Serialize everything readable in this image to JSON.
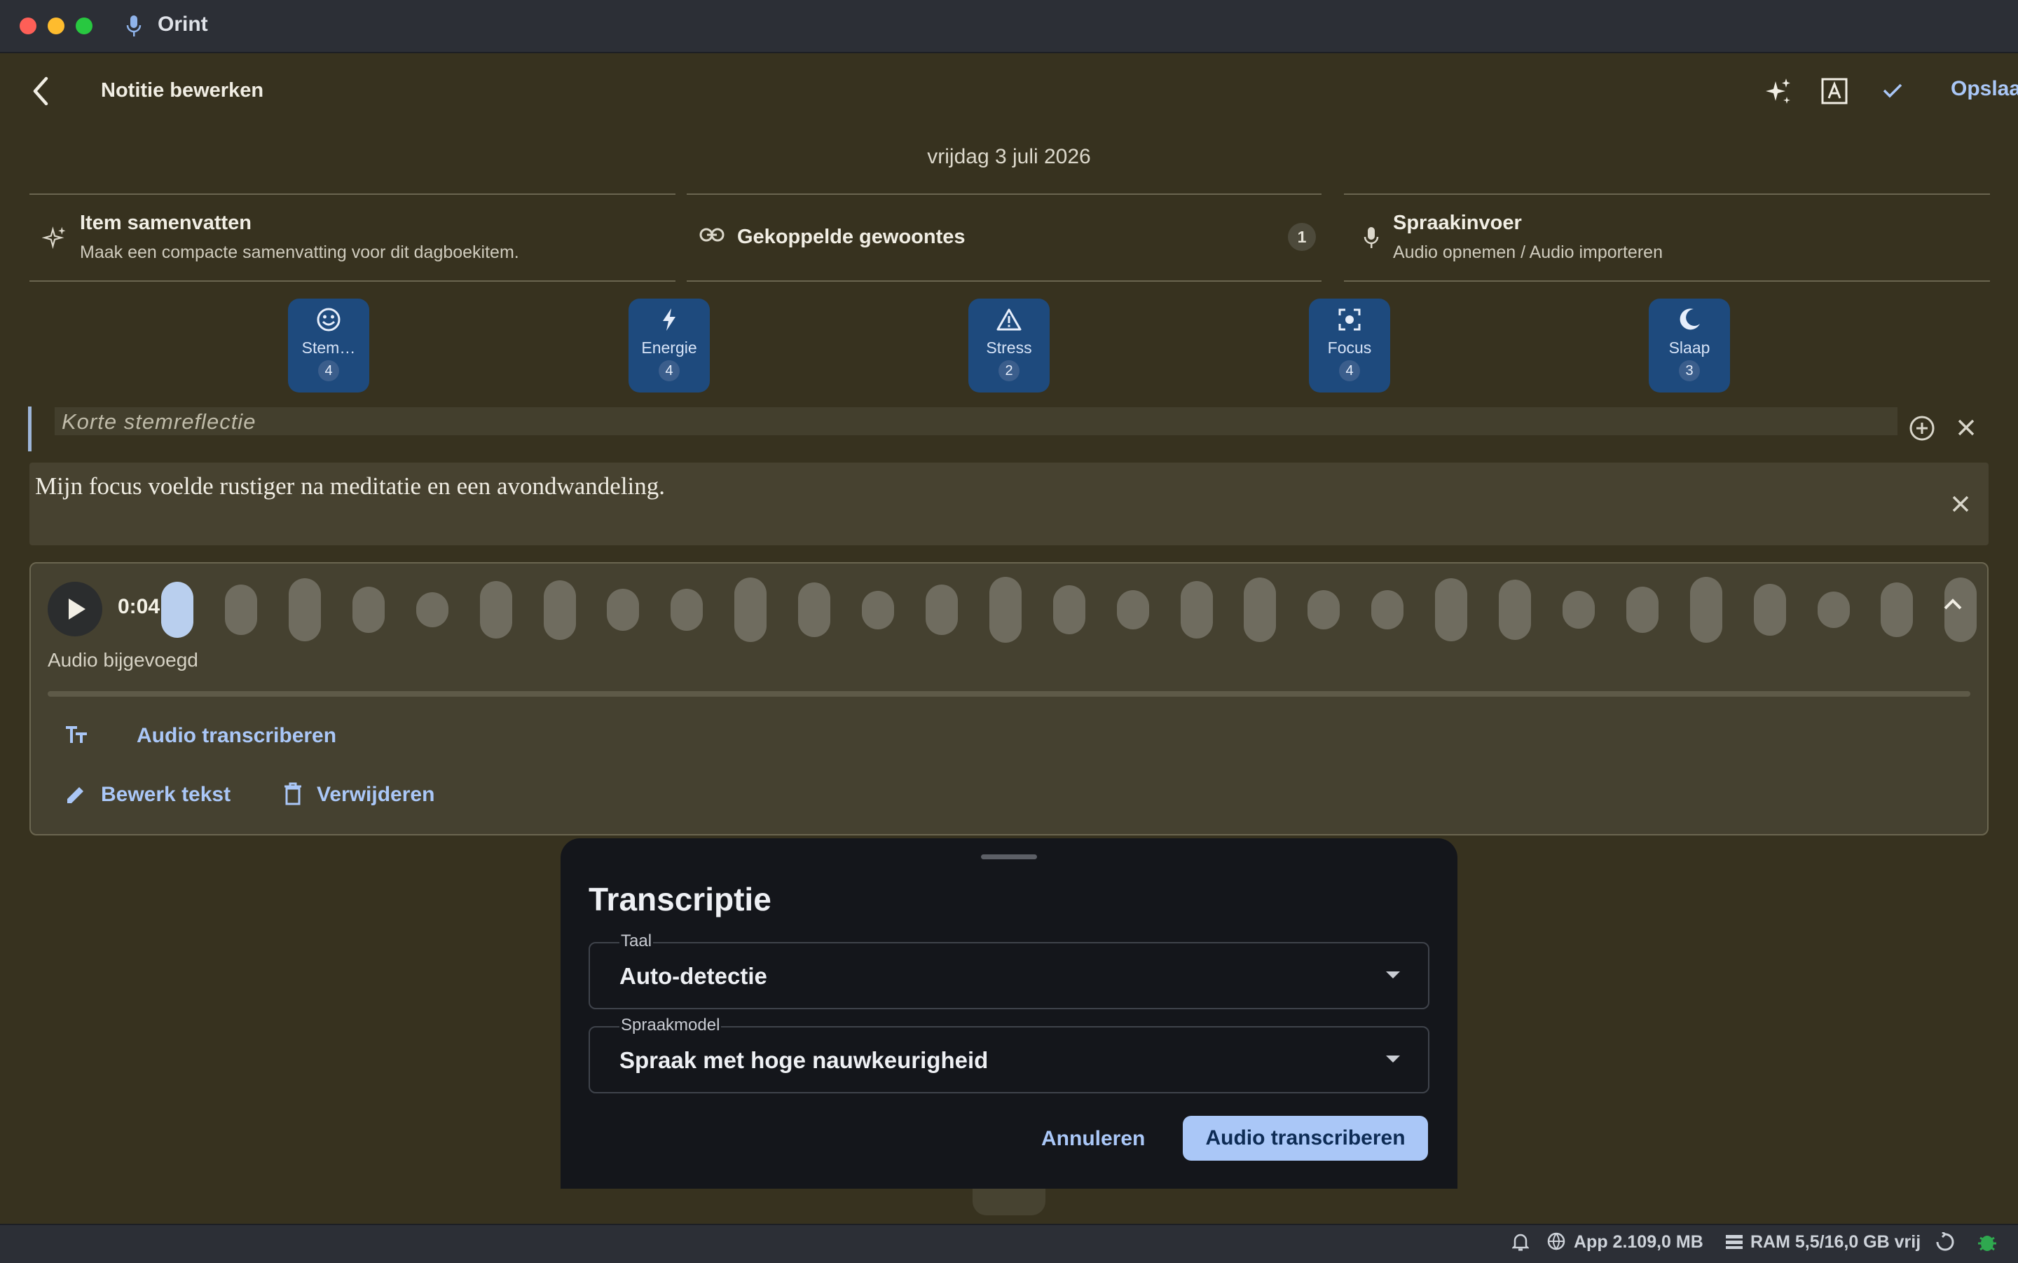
{
  "window": {
    "title": "Orint"
  },
  "header": {
    "title": "Notitie bewerken",
    "save_label": "Opslaan"
  },
  "date": "vrijdag 3 juli 2026",
  "cards": {
    "summary": {
      "title": "Item samenvatten",
      "subtitle": "Maak een compacte samenvatting voor dit dagboekitem."
    },
    "habits": {
      "title": "Gekoppelde gewoontes",
      "count": "1"
    },
    "voice": {
      "title": "Spraakinvoer",
      "subtitle": "Audio opnemen / Audio importeren"
    }
  },
  "metrics": [
    {
      "label": "Stem…",
      "value": "4",
      "icon": "smile-icon"
    },
    {
      "label": "Energie",
      "value": "4",
      "icon": "bolt-icon"
    },
    {
      "label": "Stress",
      "value": "2",
      "icon": "warning-icon"
    },
    {
      "label": "Focus",
      "value": "4",
      "icon": "focus-icon"
    },
    {
      "label": "Slaap",
      "value": "3",
      "icon": "moon-icon"
    }
  ],
  "reflection": {
    "placeholder": "Korte stemreflectie"
  },
  "note": {
    "text": "Mijn focus voelde rustiger na meditatie en een avondwandeling."
  },
  "audio": {
    "time": "0:04",
    "status": "Audio bijgevoegd",
    "transcribe_label": "Audio transcriberen",
    "edit_label": "Bewerk tekst",
    "delete_label": "Verwijderen"
  },
  "sheet": {
    "title": "Transcriptie",
    "language_label": "Taal",
    "language_value": "Auto-detectie",
    "model_label": "Spraakmodel",
    "model_value": "Spraak met hoge nauwkeurigheid",
    "cancel_label": "Annuleren",
    "confirm_label": "Audio transcriberen"
  },
  "statusbar": {
    "app_memory": "App 2.109,0 MB",
    "ram": "RAM 5,5/16,0 GB vrij"
  },
  "colors": {
    "accent": "#aac7f7",
    "chip": "#1e4a7d",
    "background": "#37321f"
  }
}
